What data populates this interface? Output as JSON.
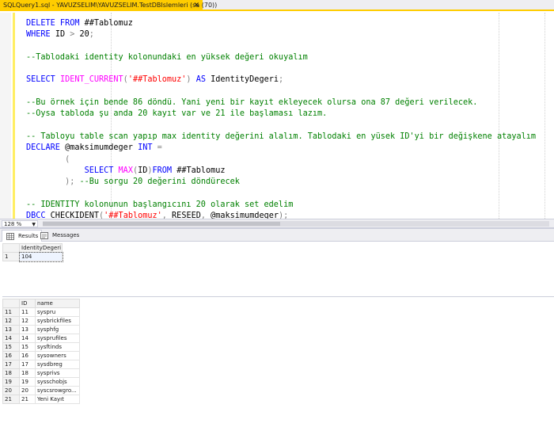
{
  "tab": {
    "title": "SQLQuery1.sql - YAVUZSELIM\\YAVUZSELIM.TestDBIslemleri (sa (70))",
    "close": "✕"
  },
  "editor": {
    "lines": [
      [
        [
          "kw",
          "DELETE FROM "
        ],
        [
          "plain",
          "##Tablomuz"
        ]
      ],
      [
        [
          "kw",
          "WHERE "
        ],
        [
          "plain",
          "ID "
        ],
        [
          "op",
          ">"
        ],
        [
          "plain",
          " 20"
        ],
        [
          "op",
          ";"
        ]
      ],
      [],
      [
        [
          "cm",
          "--Tablodaki identity kolonundaki en yüksek değeri okuyalım"
        ]
      ],
      [],
      [
        [
          "kw",
          "SELECT "
        ],
        [
          "fn",
          "IDENT_CURRENT"
        ],
        [
          "op",
          "("
        ],
        [
          "str",
          "'##Tablomuz'"
        ],
        [
          "op",
          ")"
        ],
        [
          "kw",
          " AS "
        ],
        [
          "plain",
          "IdentityDegeri"
        ],
        [
          "op",
          ";"
        ]
      ],
      [],
      [
        [
          "cm",
          "--Bu örnek için bende 86 döndü. Yani yeni bir kayıt ekleyecek olursa ona 87 değeri verilecek."
        ]
      ],
      [
        [
          "cm",
          "--Oysa tabloda şu anda 20 kayıt var ve 21 ile başlaması lazım."
        ]
      ],
      [],
      [
        [
          "cm",
          "-- Tabloyu table scan yapıp max identity değerini alalım. Tablodaki en yüsek ID'yi bir değişkene atayalım"
        ]
      ],
      [
        [
          "kw",
          "DECLARE "
        ],
        [
          "plain",
          "@maksimumdeger "
        ],
        [
          "kw",
          "INT "
        ],
        [
          "op",
          "="
        ]
      ],
      [
        [
          "plain",
          "        "
        ],
        [
          "op",
          "("
        ]
      ],
      [
        [
          "plain",
          "            "
        ],
        [
          "kw",
          "SELECT "
        ],
        [
          "fn",
          "MAX"
        ],
        [
          "op",
          "("
        ],
        [
          "plain",
          "ID"
        ],
        [
          "op",
          ")"
        ],
        [
          "kw",
          "FROM "
        ],
        [
          "plain",
          "##Tablomuz"
        ]
      ],
      [
        [
          "plain",
          "        "
        ],
        [
          "op",
          ");"
        ],
        [
          "cm",
          " --Bu sorgu 20 değerini döndürecek"
        ]
      ],
      [],
      [
        [
          "cm",
          "-- IDENTITY kolonunun başlangıcını 20 olarak set edelim"
        ]
      ],
      [
        [
          "kw",
          "DBCC "
        ],
        [
          "plain",
          "CHECKIDENT"
        ],
        [
          "op",
          "("
        ],
        [
          "str",
          "'##Tablomuz'"
        ],
        [
          "op",
          ", "
        ],
        [
          "plain",
          "RESEED"
        ],
        [
          "op",
          ", "
        ],
        [
          "plain",
          "@maksimumdeger"
        ],
        [
          "op",
          ");"
        ]
      ]
    ]
  },
  "zoom": {
    "value": "128 %",
    "arrow": "▼"
  },
  "result_tabs": [
    {
      "label": "Results"
    },
    {
      "label": "Messages"
    }
  ],
  "grid1": {
    "columns": [
      "IdentityDegeri"
    ],
    "rows": [
      {
        "rn": "1",
        "cells": [
          "104"
        ]
      }
    ]
  },
  "grid2": {
    "columns": [
      "ID",
      "name"
    ],
    "rows": [
      {
        "rn": "11",
        "cells": [
          "11",
          "syspru"
        ]
      },
      {
        "rn": "12",
        "cells": [
          "12",
          "sysbrickfiles"
        ]
      },
      {
        "rn": "13",
        "cells": [
          "13",
          "sysphfg"
        ]
      },
      {
        "rn": "14",
        "cells": [
          "14",
          "sysprufiles"
        ]
      },
      {
        "rn": "15",
        "cells": [
          "15",
          "sysftinds"
        ]
      },
      {
        "rn": "16",
        "cells": [
          "16",
          "sysowners"
        ]
      },
      {
        "rn": "17",
        "cells": [
          "17",
          "sysdbreg"
        ]
      },
      {
        "rn": "18",
        "cells": [
          "18",
          "sysprivs"
        ]
      },
      {
        "rn": "19",
        "cells": [
          "19",
          "sysschobjs"
        ]
      },
      {
        "rn": "20",
        "cells": [
          "20",
          "syscsrowgro..."
        ]
      },
      {
        "rn": "21",
        "cells": [
          "21",
          "Yeni Kayıt"
        ]
      }
    ]
  },
  "colors": {
    "keyword": "#0000ff",
    "comment": "#008000",
    "string": "#ff0000",
    "function": "#ff00ff",
    "operator": "#808080",
    "tab_accent": "#ffcc00"
  }
}
